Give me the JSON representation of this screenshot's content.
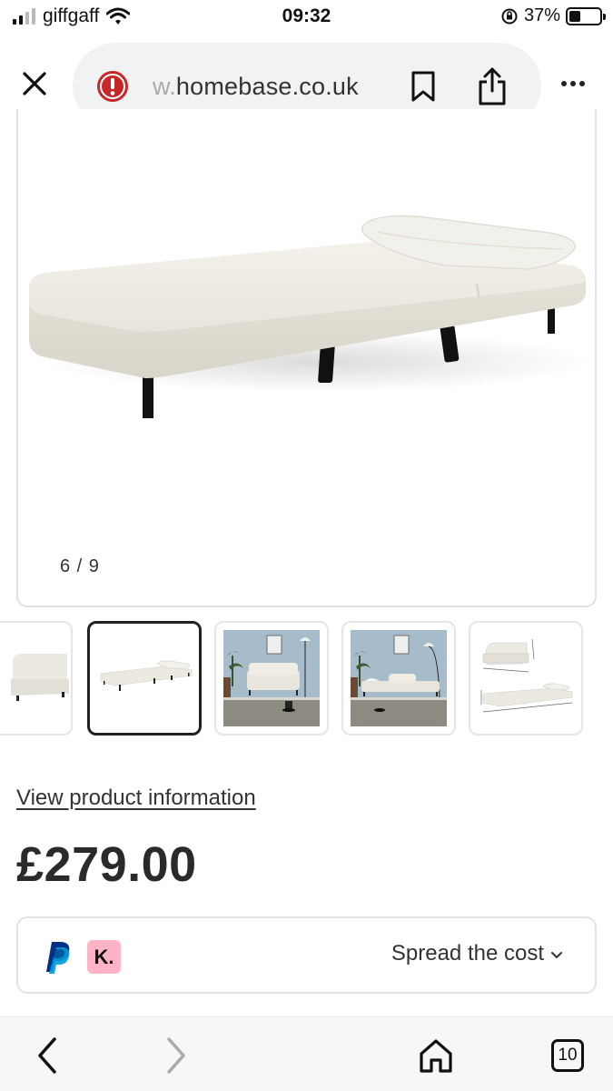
{
  "status_bar": {
    "carrier": "giffgaff",
    "time": "09:32",
    "battery_pct": "37%",
    "battery_level": 0.37
  },
  "browser": {
    "url_faded": "w.",
    "url_main": "homebase.co.uk",
    "icons": [
      "close-icon",
      "warning-icon",
      "bookmark-icon",
      "share-icon",
      "more-icon"
    ]
  },
  "gallery": {
    "counter": "6 / 9",
    "current_index": 6,
    "total": 9,
    "selected_thumb": 1
  },
  "product": {
    "view_info_link": "View product information",
    "price": "£279.00"
  },
  "payment": {
    "klarna_mark": "K.",
    "spread_label": "Spread the cost"
  },
  "bottom_bar": {
    "tabs_count": "10",
    "icons": [
      "back-icon",
      "forward-icon",
      "home-icon",
      "tabs-icon"
    ]
  },
  "colors": {
    "warning_red": "#c62828",
    "klarna_pink": "#ffb3c7",
    "paypal_dark": "#003087",
    "paypal_light": "#009cde"
  }
}
